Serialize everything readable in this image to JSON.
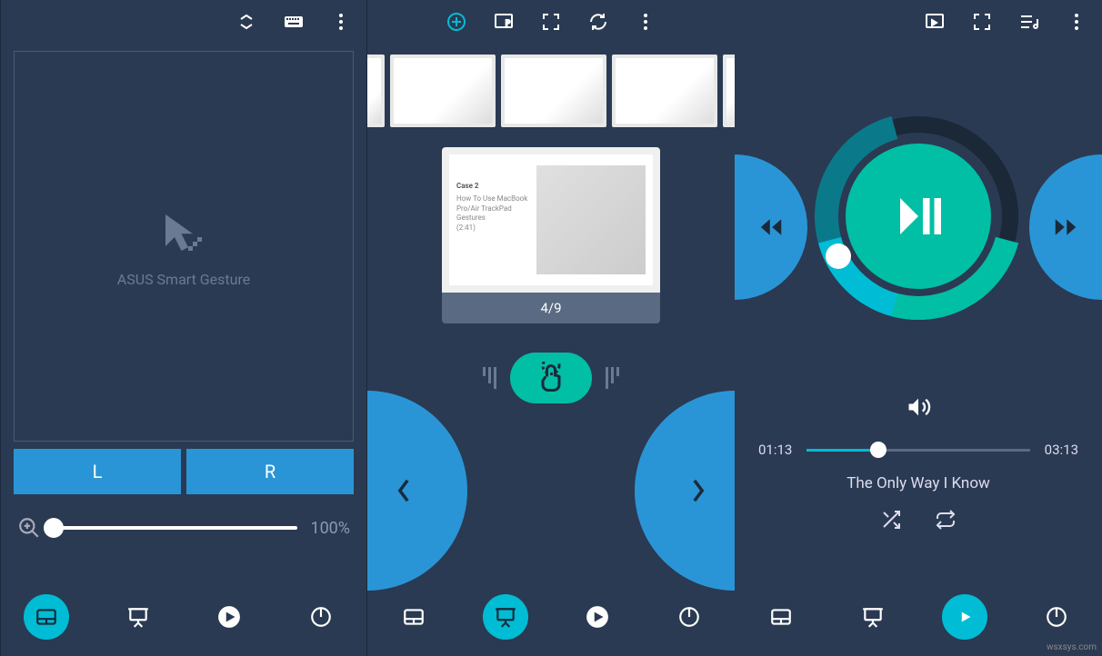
{
  "colors": {
    "accent": "#00bcd4",
    "teal": "#00bfa5",
    "blue": "#2a95d6",
    "bg": "#2a3a52"
  },
  "panel1": {
    "trackpad_label": "ASUS Smart Gesture",
    "left_btn": "L",
    "right_btn": "R",
    "zoom_value": "100%"
  },
  "panel2": {
    "slide_counter": "4/9",
    "slide_case": "Case 2",
    "slide_subtitle_1": "How To Use MacBook Pro/Air TrackPad Gestures",
    "slide_subtitle_2": "(2:41)"
  },
  "panel3": {
    "time_current": "01:13",
    "time_total": "03:13",
    "song_title": "The Only Way I Know",
    "progress_percent": 32
  },
  "nav": {
    "items": [
      "trackpad",
      "presentation",
      "media",
      "power"
    ]
  },
  "watermark": "wsxsys.com"
}
